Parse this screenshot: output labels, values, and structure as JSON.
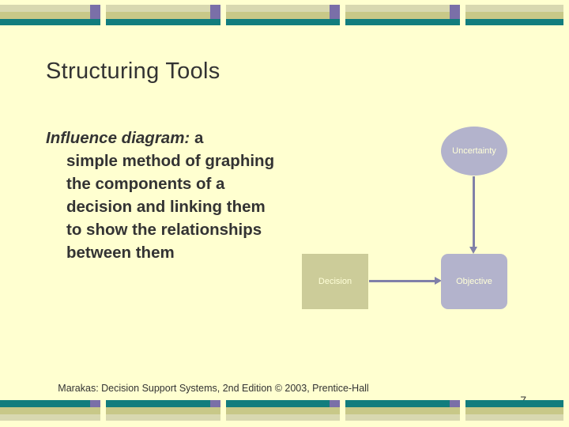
{
  "slide": {
    "title": "Structuring Tools",
    "body": {
      "lead": "Influence diagram:",
      "rest_first_line": " a",
      "continuation": "simple method of graphing the components of a decision and linking them to show the relationships between them"
    },
    "diagram": {
      "nodes": [
        {
          "id": "uncertainty",
          "label": "Uncertainty",
          "shape": "ellipse",
          "color": "#b3b3cc"
        },
        {
          "id": "decision",
          "label": "Decision",
          "shape": "rectangle",
          "color": "#cccc99"
        },
        {
          "id": "objective",
          "label": "Objective",
          "shape": "rounded-rectangle",
          "color": "#b3b3cc"
        }
      ],
      "arrows": [
        {
          "from": "uncertainty",
          "to": "objective",
          "direction": "down"
        },
        {
          "from": "decision",
          "to": "objective",
          "direction": "right"
        }
      ],
      "arrow_color": "#8080a8"
    },
    "footer": {
      "credit": "Marakas: Decision Support Systems, 2nd Edition  © 2003, Prentice-Hall",
      "page_number": "7"
    },
    "decor": {
      "pale": "#d8d8b0",
      "olive": "#c8c888",
      "teal": "#127d7d",
      "purple": "#7a6fa8",
      "background": "#ffffd0"
    }
  }
}
